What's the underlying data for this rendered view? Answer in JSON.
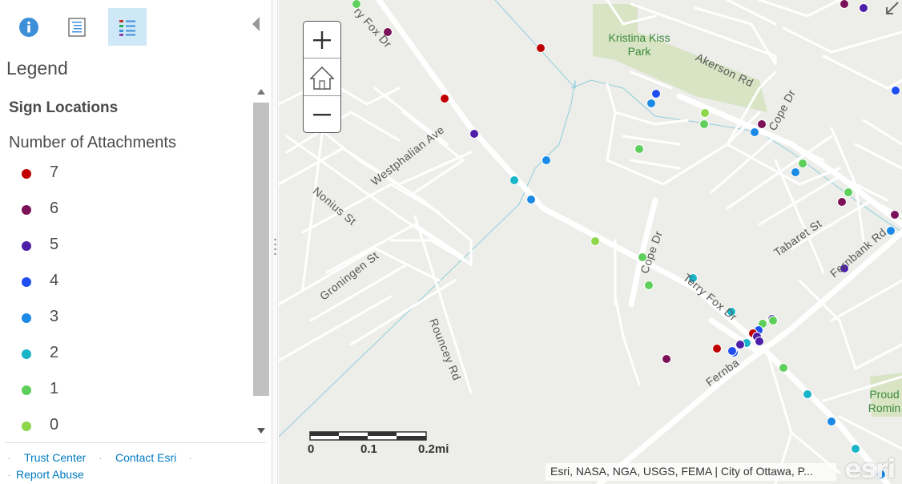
{
  "toolbar": {
    "about_icon": "info-icon",
    "content_icon": "content-list-icon",
    "legend_icon": "legend-list-icon",
    "collapse_icon": "chevron-left-icon"
  },
  "legend": {
    "title": "Legend",
    "layer_title": "Sign Locations",
    "field_title": "Number of Attachments",
    "items": [
      {
        "label": "7",
        "color": "#c00000"
      },
      {
        "label": "6",
        "color": "#7b1158"
      },
      {
        "label": "5",
        "color": "#4d1ea8"
      },
      {
        "label": "4",
        "color": "#1f4ff0"
      },
      {
        "label": "3",
        "color": "#1a8ae6"
      },
      {
        "label": "2",
        "color": "#1ab4c8"
      },
      {
        "label": "1",
        "color": "#5dcf5a"
      },
      {
        "label": "0",
        "color": "#8ed64a"
      }
    ]
  },
  "footer": {
    "trust_center": "Trust Center",
    "contact_esri": "Contact Esri",
    "report_abuse": "Report Abuse"
  },
  "map": {
    "zoom_in_icon": "plus-icon",
    "home_icon": "home-icon",
    "zoom_out_icon": "minus-icon",
    "scale": {
      "labels": [
        "0",
        "0.1",
        "0.2mi"
      ]
    },
    "attribution": "Esri, NASA, NGA, USGS, FEMA | City of Ottawa, P...",
    "logo": "esri",
    "expand_icon": "expand-arrow-icon",
    "streets": {
      "terry_fox_top": "ry Fox Dr",
      "westphalian": "Westphalian Ave",
      "nonius": "Nonius St",
      "groningen": "Groningen St",
      "rouncey": "Rouncey Rd",
      "akerson": "Akerson Rd",
      "cope_top": "Cope Dr",
      "cope_mid": "Cope Dr",
      "tabaret": "Tabaret St",
      "fernbank": "Fernbank Rd",
      "terry_fox_mid": "Terry Fox Dr",
      "fernbank_low": "Fernba"
    },
    "parks": {
      "kristina_kiss": "Kristina Kiss Park",
      "proud_line1": "Proud",
      "proud_line2": "Romin"
    }
  }
}
